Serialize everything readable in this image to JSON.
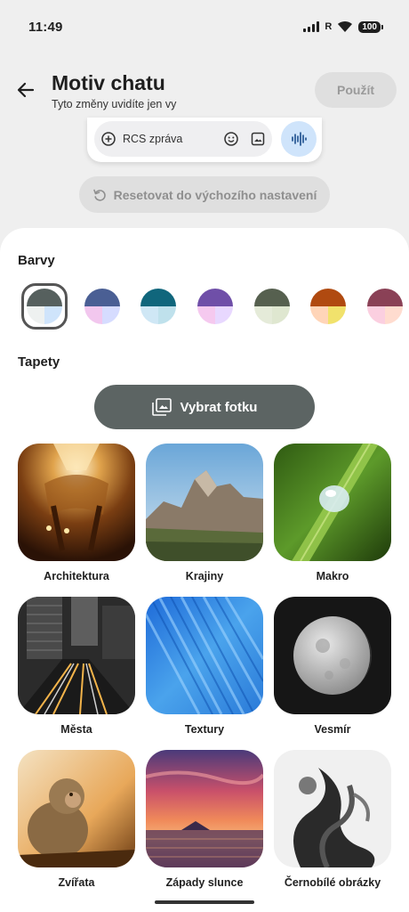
{
  "status": {
    "time": "11:49",
    "network": "R",
    "battery": "100"
  },
  "header": {
    "title": "Motiv chatu",
    "subtitle": "Tyto změny uvidíte jen vy",
    "apply_label": "Použít"
  },
  "preview": {
    "placeholder": "RCS zpráva"
  },
  "reset_label": "Resetovat do výchozího nastavení",
  "colors": {
    "title": "Barvy",
    "swatches": [
      {
        "top": "#56605e",
        "bl": "#eef1f0",
        "br": "#cfe4fb"
      },
      {
        "top": "#4a5f94",
        "bl": "#f2c7ee",
        "br": "#d6dcff"
      },
      {
        "top": "#10667c",
        "bl": "#cfe7f5",
        "br": "#bfe1ec"
      },
      {
        "top": "#6f4fa8",
        "bl": "#f5c9ef",
        "br": "#e8d8ff"
      },
      {
        "top": "#56604f",
        "bl": "#e5ebd9",
        "br": "#dfe7d0"
      },
      {
        "top": "#b04a10",
        "bl": "#ffd5b8",
        "br": "#f1e26c"
      },
      {
        "top": "#8a4156",
        "bl": "#fbcfe0",
        "br": "#ffdccf"
      }
    ]
  },
  "wallpapers": {
    "title": "Tapety",
    "pick_label": "Vybrat fotku",
    "items": [
      {
        "label": "Architektura"
      },
      {
        "label": "Krajiny"
      },
      {
        "label": "Makro"
      },
      {
        "label": "Města"
      },
      {
        "label": "Textury"
      },
      {
        "label": "Vesmír"
      },
      {
        "label": "Zvířata"
      },
      {
        "label": "Západy slunce"
      },
      {
        "label": "Černobílé obrázky"
      }
    ]
  }
}
